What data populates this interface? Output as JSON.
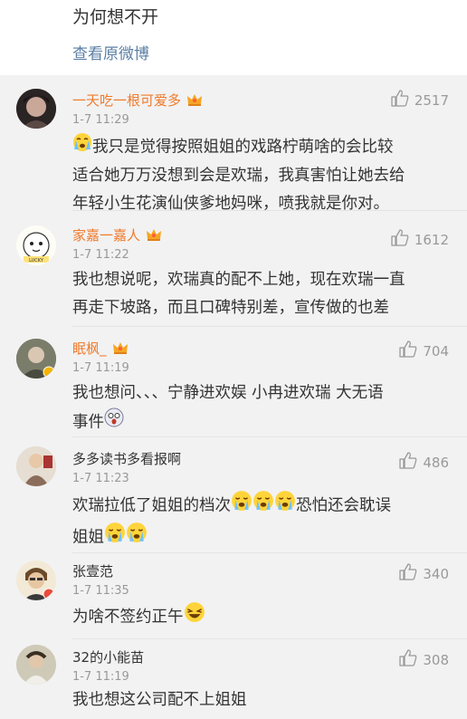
{
  "top": {
    "text": "为何想不开",
    "link": "查看原微博"
  },
  "comments": [
    {
      "name": "一天吃一根可爱多",
      "vip": true,
      "time": "1-7 11:29",
      "likes": "2517",
      "lines": [
        "我只是觉得按照姐姐的戏路柠萌啥的会比较",
        "适合她万万没想到会是欢瑞，我真害怕让她去给",
        "年轻小生花演仙侠爹地妈咪，喷我就是你对。"
      ]
    },
    {
      "name": "家嘉一嘉人",
      "vip": true,
      "time": "1-7 11:22",
      "likes": "1612",
      "lines": [
        "我也想说呢，欢瑞真的配不上她，现在欢瑞一直",
        "再走下坡路，而且口碑特别差，宣传做的也差"
      ]
    },
    {
      "name": "眠枫_",
      "vip": true,
      "time": "1-7 11:19",
      "likes": "704",
      "lines": [
        "我也想问、、、宁静进欢娱 小冉进欢瑞 大无语",
        "事件"
      ]
    },
    {
      "name": "多多读书多看报啊",
      "vip": false,
      "time": "1-7 11:23",
      "likes": "486",
      "lines": [
        "欢瑞拉低了姐姐的档次",
        "恐怕还会耽误",
        "姐姐"
      ]
    },
    {
      "name": "张壹范",
      "vip": false,
      "time": "1-7 11:35",
      "likes": "340",
      "lines": [
        "为啥不签约正午"
      ]
    },
    {
      "name": "32的小能苗",
      "vip": false,
      "time": "1-7 11:19",
      "likes": "308",
      "lines": [
        "我也想这公司配不上姐姐"
      ]
    }
  ],
  "icons": {
    "like": "thumbs-up-icon",
    "vip": "crown-icon"
  },
  "colors": {
    "vip_name": "#f07a2c",
    "link": "#5b7fa6",
    "muted": "#999999"
  }
}
